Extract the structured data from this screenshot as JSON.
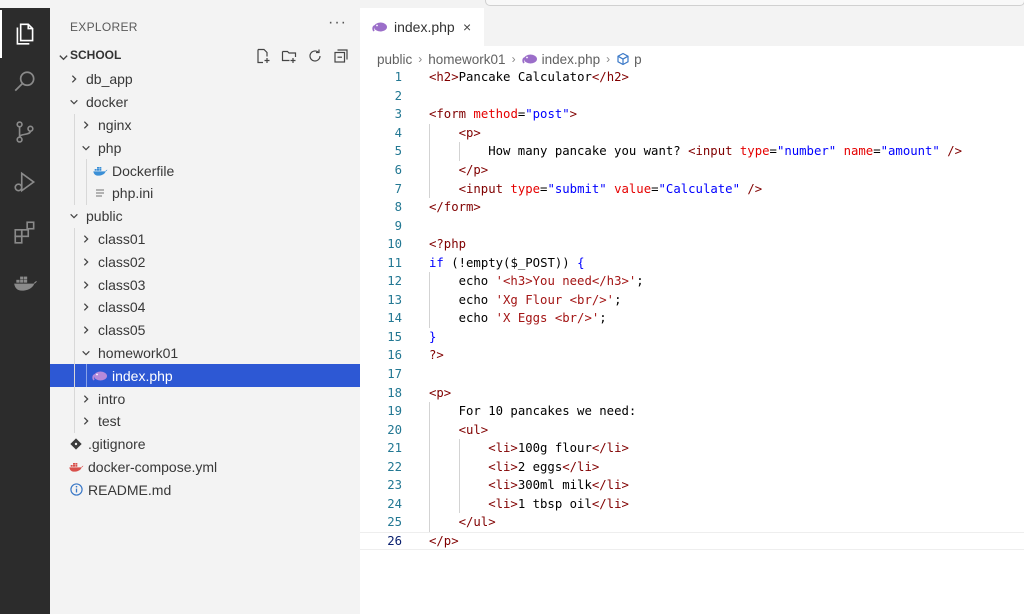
{
  "explorer": {
    "title": "EXPLORER",
    "more": "···",
    "section": "SCHOOL",
    "tree": [
      {
        "label": "db_app",
        "type": "folder",
        "depth": 0,
        "open": false
      },
      {
        "label": "docker",
        "type": "folder",
        "depth": 0,
        "open": true
      },
      {
        "label": "nginx",
        "type": "folder",
        "depth": 1,
        "open": false
      },
      {
        "label": "php",
        "type": "folder",
        "depth": 1,
        "open": true
      },
      {
        "label": "Dockerfile",
        "type": "file",
        "icon": "docker-icon",
        "depth": 2
      },
      {
        "label": "php.ini",
        "type": "file",
        "icon": "lines-icon",
        "depth": 2
      },
      {
        "label": "public",
        "type": "folder",
        "depth": 0,
        "open": true
      },
      {
        "label": "class01",
        "type": "folder",
        "depth": 1,
        "open": false
      },
      {
        "label": "class02",
        "type": "folder",
        "depth": 1,
        "open": false
      },
      {
        "label": "class03",
        "type": "folder",
        "depth": 1,
        "open": false
      },
      {
        "label": "class04",
        "type": "folder",
        "depth": 1,
        "open": false
      },
      {
        "label": "class05",
        "type": "folder",
        "depth": 1,
        "open": false
      },
      {
        "label": "homework01",
        "type": "folder",
        "depth": 1,
        "open": true
      },
      {
        "label": "index.php",
        "type": "file",
        "icon": "php-elephant-icon",
        "depth": 2,
        "selected": true
      },
      {
        "label": "intro",
        "type": "folder",
        "depth": 1,
        "open": false
      },
      {
        "label": "test",
        "type": "folder",
        "depth": 1,
        "open": false
      },
      {
        "label": ".gitignore",
        "type": "file",
        "icon": "git-icon",
        "depth": 0
      },
      {
        "label": "docker-compose.yml",
        "type": "file",
        "icon": "docker-compose-icon",
        "depth": 0
      },
      {
        "label": "README.md",
        "type": "file",
        "icon": "info-icon",
        "depth": 0
      }
    ]
  },
  "editor": {
    "tab": {
      "label": "index.php",
      "close": "×"
    },
    "breadcrumb": [
      "public",
      "homework01",
      "index.php",
      "p"
    ],
    "current_line": 26,
    "lines": [
      {
        "n": "1",
        "indent": 0,
        "tokens": [
          [
            "tg",
            "<h2>"
          ],
          [
            "pl",
            "Pancake Calculator"
          ],
          [
            "tg",
            "</h2>"
          ]
        ]
      },
      {
        "n": "2",
        "indent": 0,
        "tokens": []
      },
      {
        "n": "3",
        "indent": 0,
        "tokens": [
          [
            "tg",
            "<form "
          ],
          [
            "at",
            "method"
          ],
          [
            "pl",
            "="
          ],
          [
            "sv",
            "\"post\""
          ],
          [
            "tg",
            ">"
          ]
        ]
      },
      {
        "n": "4",
        "indent": 1,
        "tokens": [
          [
            "tg",
            "<p>"
          ]
        ]
      },
      {
        "n": "5",
        "indent": 2,
        "tokens": [
          [
            "pl",
            "How many pancake you want? "
          ],
          [
            "tg",
            "<input "
          ],
          [
            "at",
            "type"
          ],
          [
            "pl",
            "="
          ],
          [
            "sv",
            "\"number\""
          ],
          [
            "pl",
            " "
          ],
          [
            "at",
            "name"
          ],
          [
            "pl",
            "="
          ],
          [
            "sv",
            "\"amount\""
          ],
          [
            "pl",
            " "
          ],
          [
            "tg",
            "/>"
          ]
        ]
      },
      {
        "n": "6",
        "indent": 1,
        "tokens": [
          [
            "tg",
            "</p>"
          ]
        ]
      },
      {
        "n": "7",
        "indent": 1,
        "tokens": [
          [
            "tg",
            "<input "
          ],
          [
            "at",
            "type"
          ],
          [
            "pl",
            "="
          ],
          [
            "sv",
            "\"submit\""
          ],
          [
            "pl",
            " "
          ],
          [
            "at",
            "value"
          ],
          [
            "pl",
            "="
          ],
          [
            "sv",
            "\"Calculate\""
          ],
          [
            "pl",
            " "
          ],
          [
            "tg",
            "/>"
          ]
        ]
      },
      {
        "n": "8",
        "indent": 0,
        "tokens": [
          [
            "tg",
            "</form>"
          ]
        ]
      },
      {
        "n": "9",
        "indent": 0,
        "tokens": []
      },
      {
        "n": "10",
        "indent": 0,
        "tokens": [
          [
            "tg",
            "<?php"
          ]
        ]
      },
      {
        "n": "11",
        "indent": 0,
        "tokens": [
          [
            "kw",
            "if"
          ],
          [
            "pl",
            " (!empty("
          ],
          [
            "pl",
            "$_POST"
          ],
          [
            "pl",
            ")) "
          ],
          [
            "kw",
            "{"
          ]
        ]
      },
      {
        "n": "12",
        "indent": 1,
        "tokens": [
          [
            "pl",
            "echo "
          ],
          [
            "st",
            "'<h3>You need</h3>'"
          ],
          [
            "pl",
            ";"
          ]
        ]
      },
      {
        "n": "13",
        "indent": 1,
        "tokens": [
          [
            "pl",
            "echo "
          ],
          [
            "st",
            "'Xg Flour <br/>'"
          ],
          [
            "pl",
            ";"
          ]
        ]
      },
      {
        "n": "14",
        "indent": 1,
        "tokens": [
          [
            "pl",
            "echo "
          ],
          [
            "st",
            "'X Eggs <br/>'"
          ],
          [
            "pl",
            ";"
          ]
        ]
      },
      {
        "n": "15",
        "indent": 0,
        "tokens": [
          [
            "kw",
            "}"
          ]
        ]
      },
      {
        "n": "16",
        "indent": 0,
        "tokens": [
          [
            "tg",
            "?>"
          ]
        ]
      },
      {
        "n": "17",
        "indent": 0,
        "tokens": []
      },
      {
        "n": "18",
        "indent": 0,
        "tokens": [
          [
            "tg",
            "<p>"
          ]
        ]
      },
      {
        "n": "19",
        "indent": 1,
        "tokens": [
          [
            "pl",
            "For 10 pancakes we need:"
          ]
        ]
      },
      {
        "n": "20",
        "indent": 1,
        "tokens": [
          [
            "tg",
            "<ul>"
          ]
        ]
      },
      {
        "n": "21",
        "indent": 2,
        "tokens": [
          [
            "tg",
            "<li>"
          ],
          [
            "pl",
            "100g flour"
          ],
          [
            "tg",
            "</li>"
          ]
        ]
      },
      {
        "n": "22",
        "indent": 2,
        "tokens": [
          [
            "tg",
            "<li>"
          ],
          [
            "pl",
            "2 eggs"
          ],
          [
            "tg",
            "</li>"
          ]
        ]
      },
      {
        "n": "23",
        "indent": 2,
        "tokens": [
          [
            "tg",
            "<li>"
          ],
          [
            "pl",
            "300ml milk"
          ],
          [
            "tg",
            "</li>"
          ]
        ]
      },
      {
        "n": "24",
        "indent": 2,
        "tokens": [
          [
            "tg",
            "<li>"
          ],
          [
            "pl",
            "1 tbsp oil"
          ],
          [
            "tg",
            "</li>"
          ]
        ]
      },
      {
        "n": "25",
        "indent": 1,
        "tokens": [
          [
            "tg",
            "</ul>"
          ]
        ]
      },
      {
        "n": "26",
        "indent": 0,
        "tokens": [
          [
            "tg",
            "</p>"
          ]
        ]
      }
    ]
  },
  "colors": {
    "selection": "#2d58d4",
    "activity_bar": "#2c2c2c",
    "sidebar": "#f3f3f3",
    "tag": "#800000",
    "attribute": "#e50000",
    "string": "#0000ff"
  }
}
